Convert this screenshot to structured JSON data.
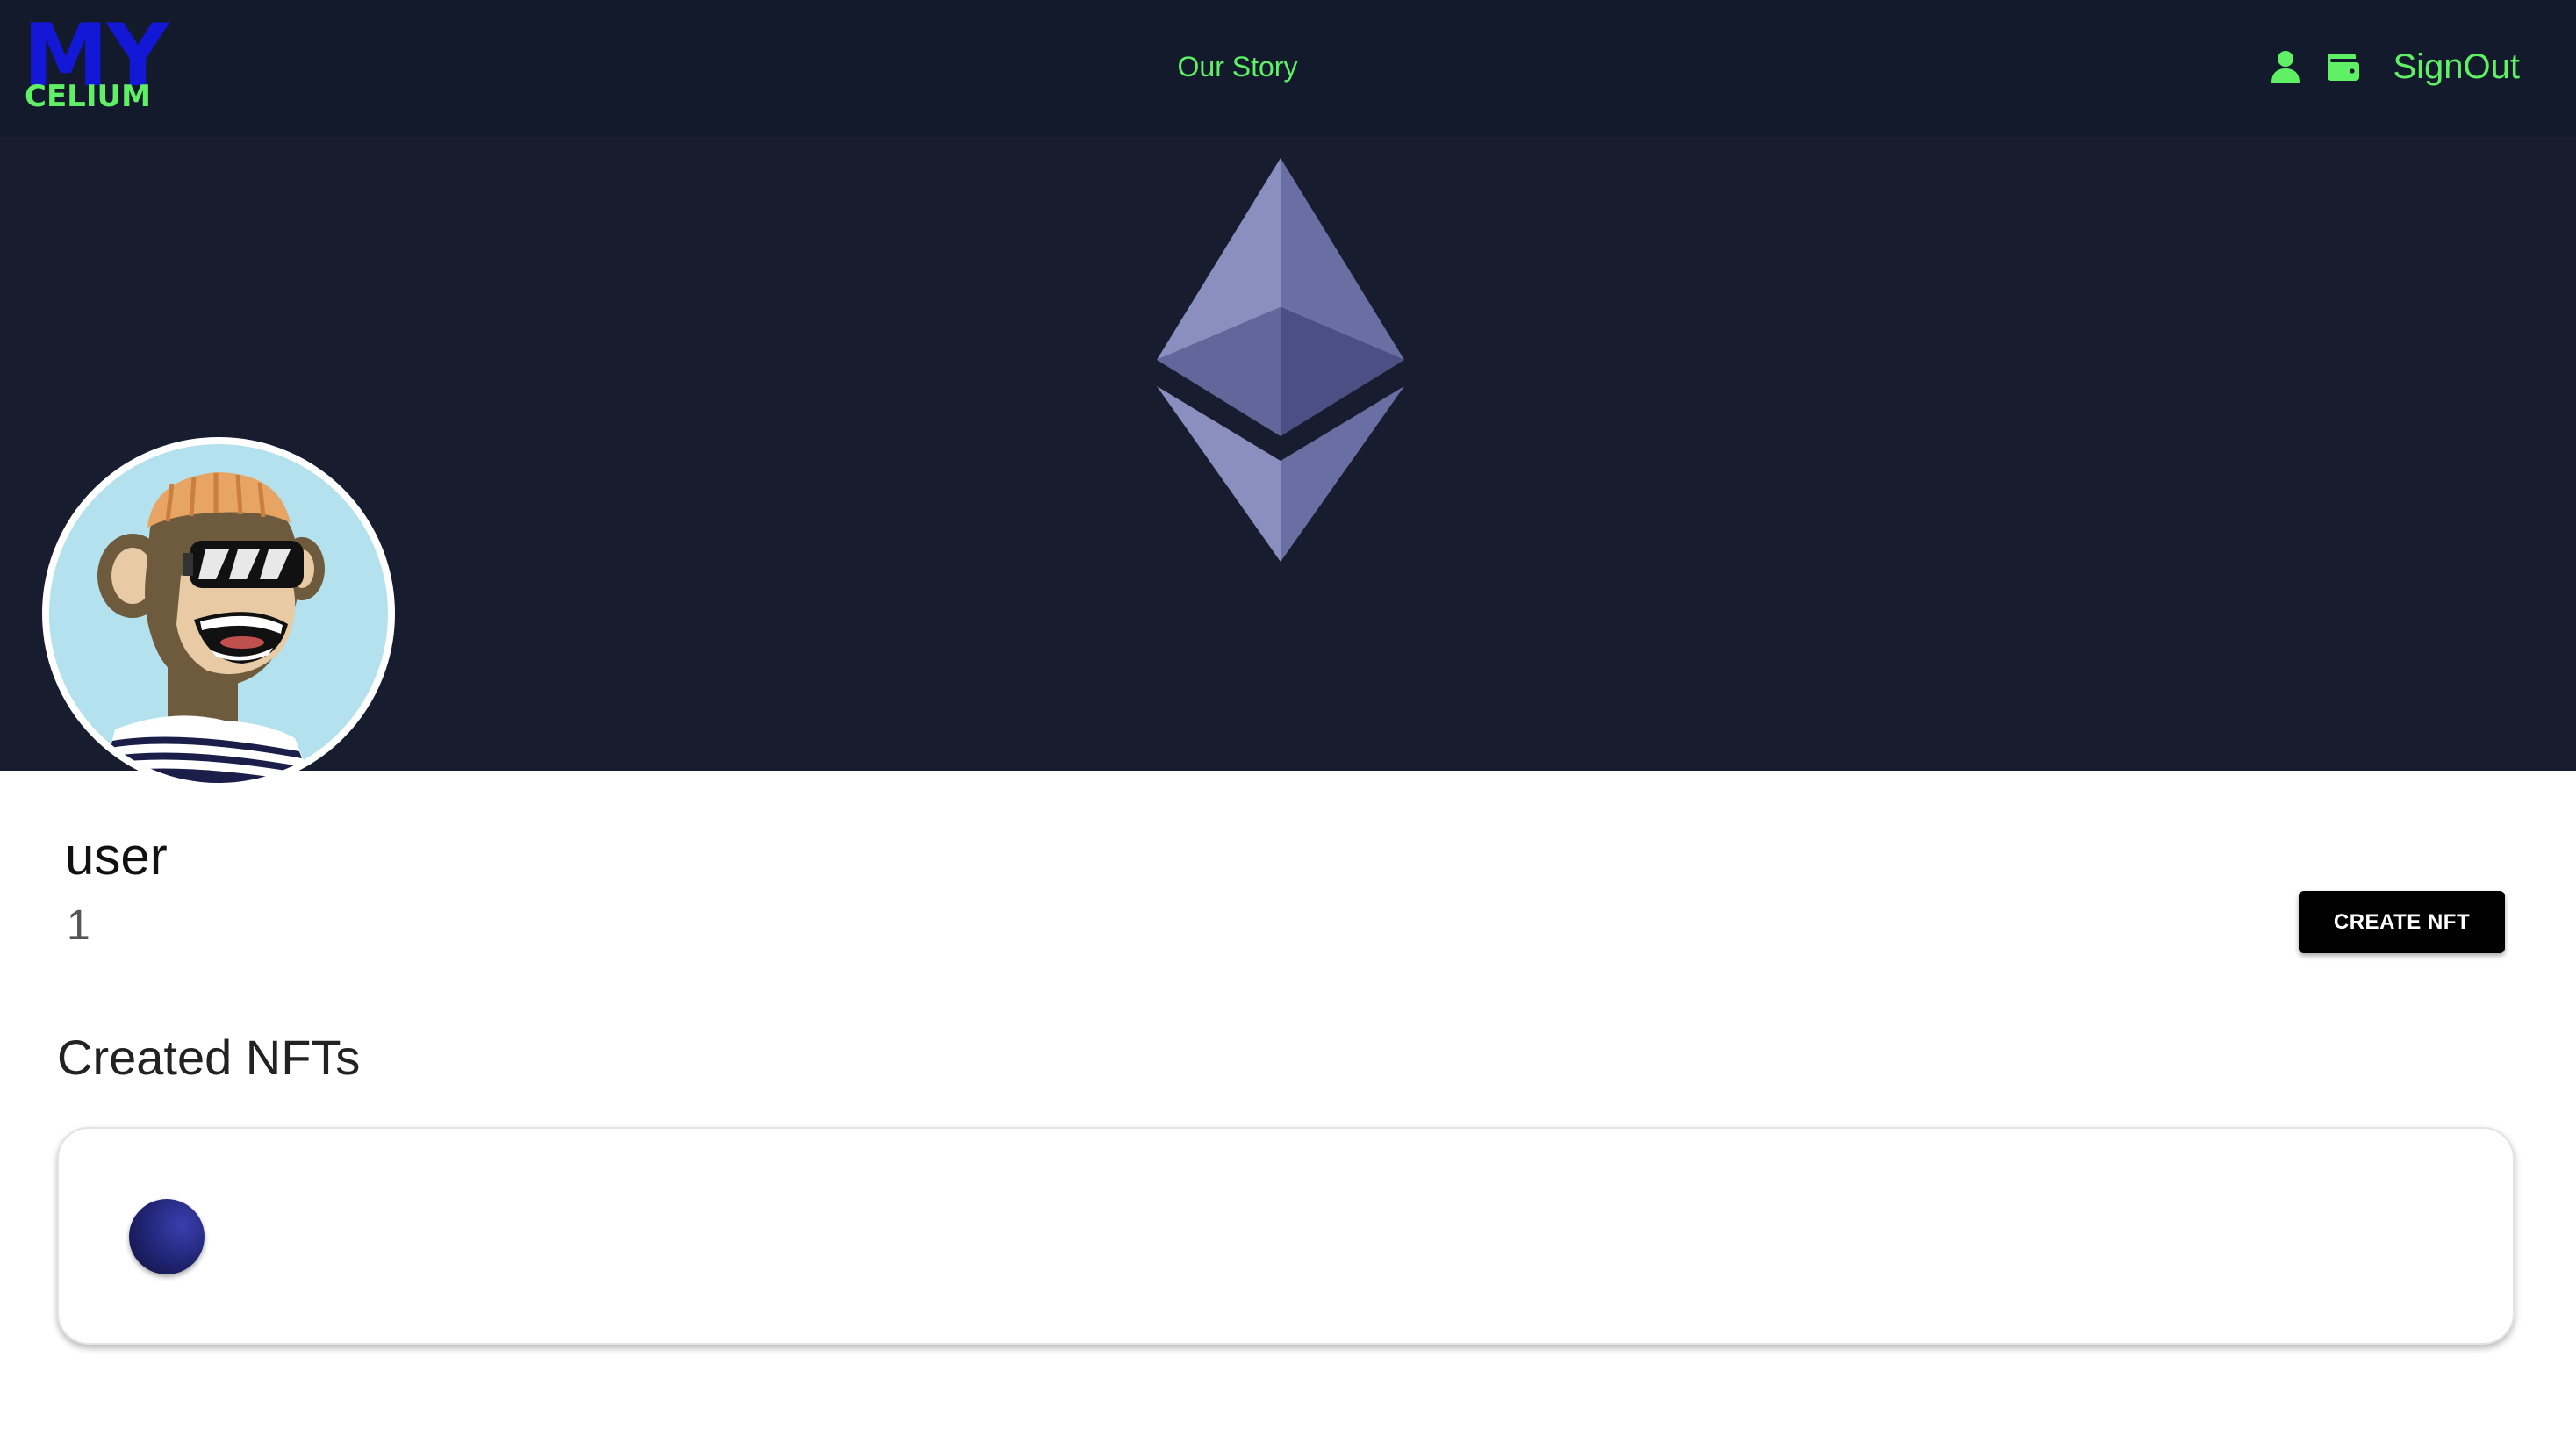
{
  "navbar": {
    "logo_top": "MY",
    "logo_bottom": "CELIUM",
    "story_link": "Our Story",
    "profile_icon": "user-icon",
    "wallet_icon": "wallet-icon",
    "signout_label": "SignOut"
  },
  "banner": {
    "logo_icon": "ethereum-logo"
  },
  "profile": {
    "avatar": "bored-ape-avatar",
    "username": "user",
    "count": "1",
    "create_button_label": "CREATE NFT"
  },
  "created_nfts": {
    "title": "Created NFTs",
    "items": [
      {
        "thumbnail": "nft-thumbnail-circle"
      }
    ]
  },
  "colors": {
    "navbar_bg": "#131a2b",
    "banner_bg": "#181c2f",
    "accent_green": "#5ff065",
    "logo_blue": "#1218d6",
    "avatar_bg": "#b3e1ee"
  }
}
